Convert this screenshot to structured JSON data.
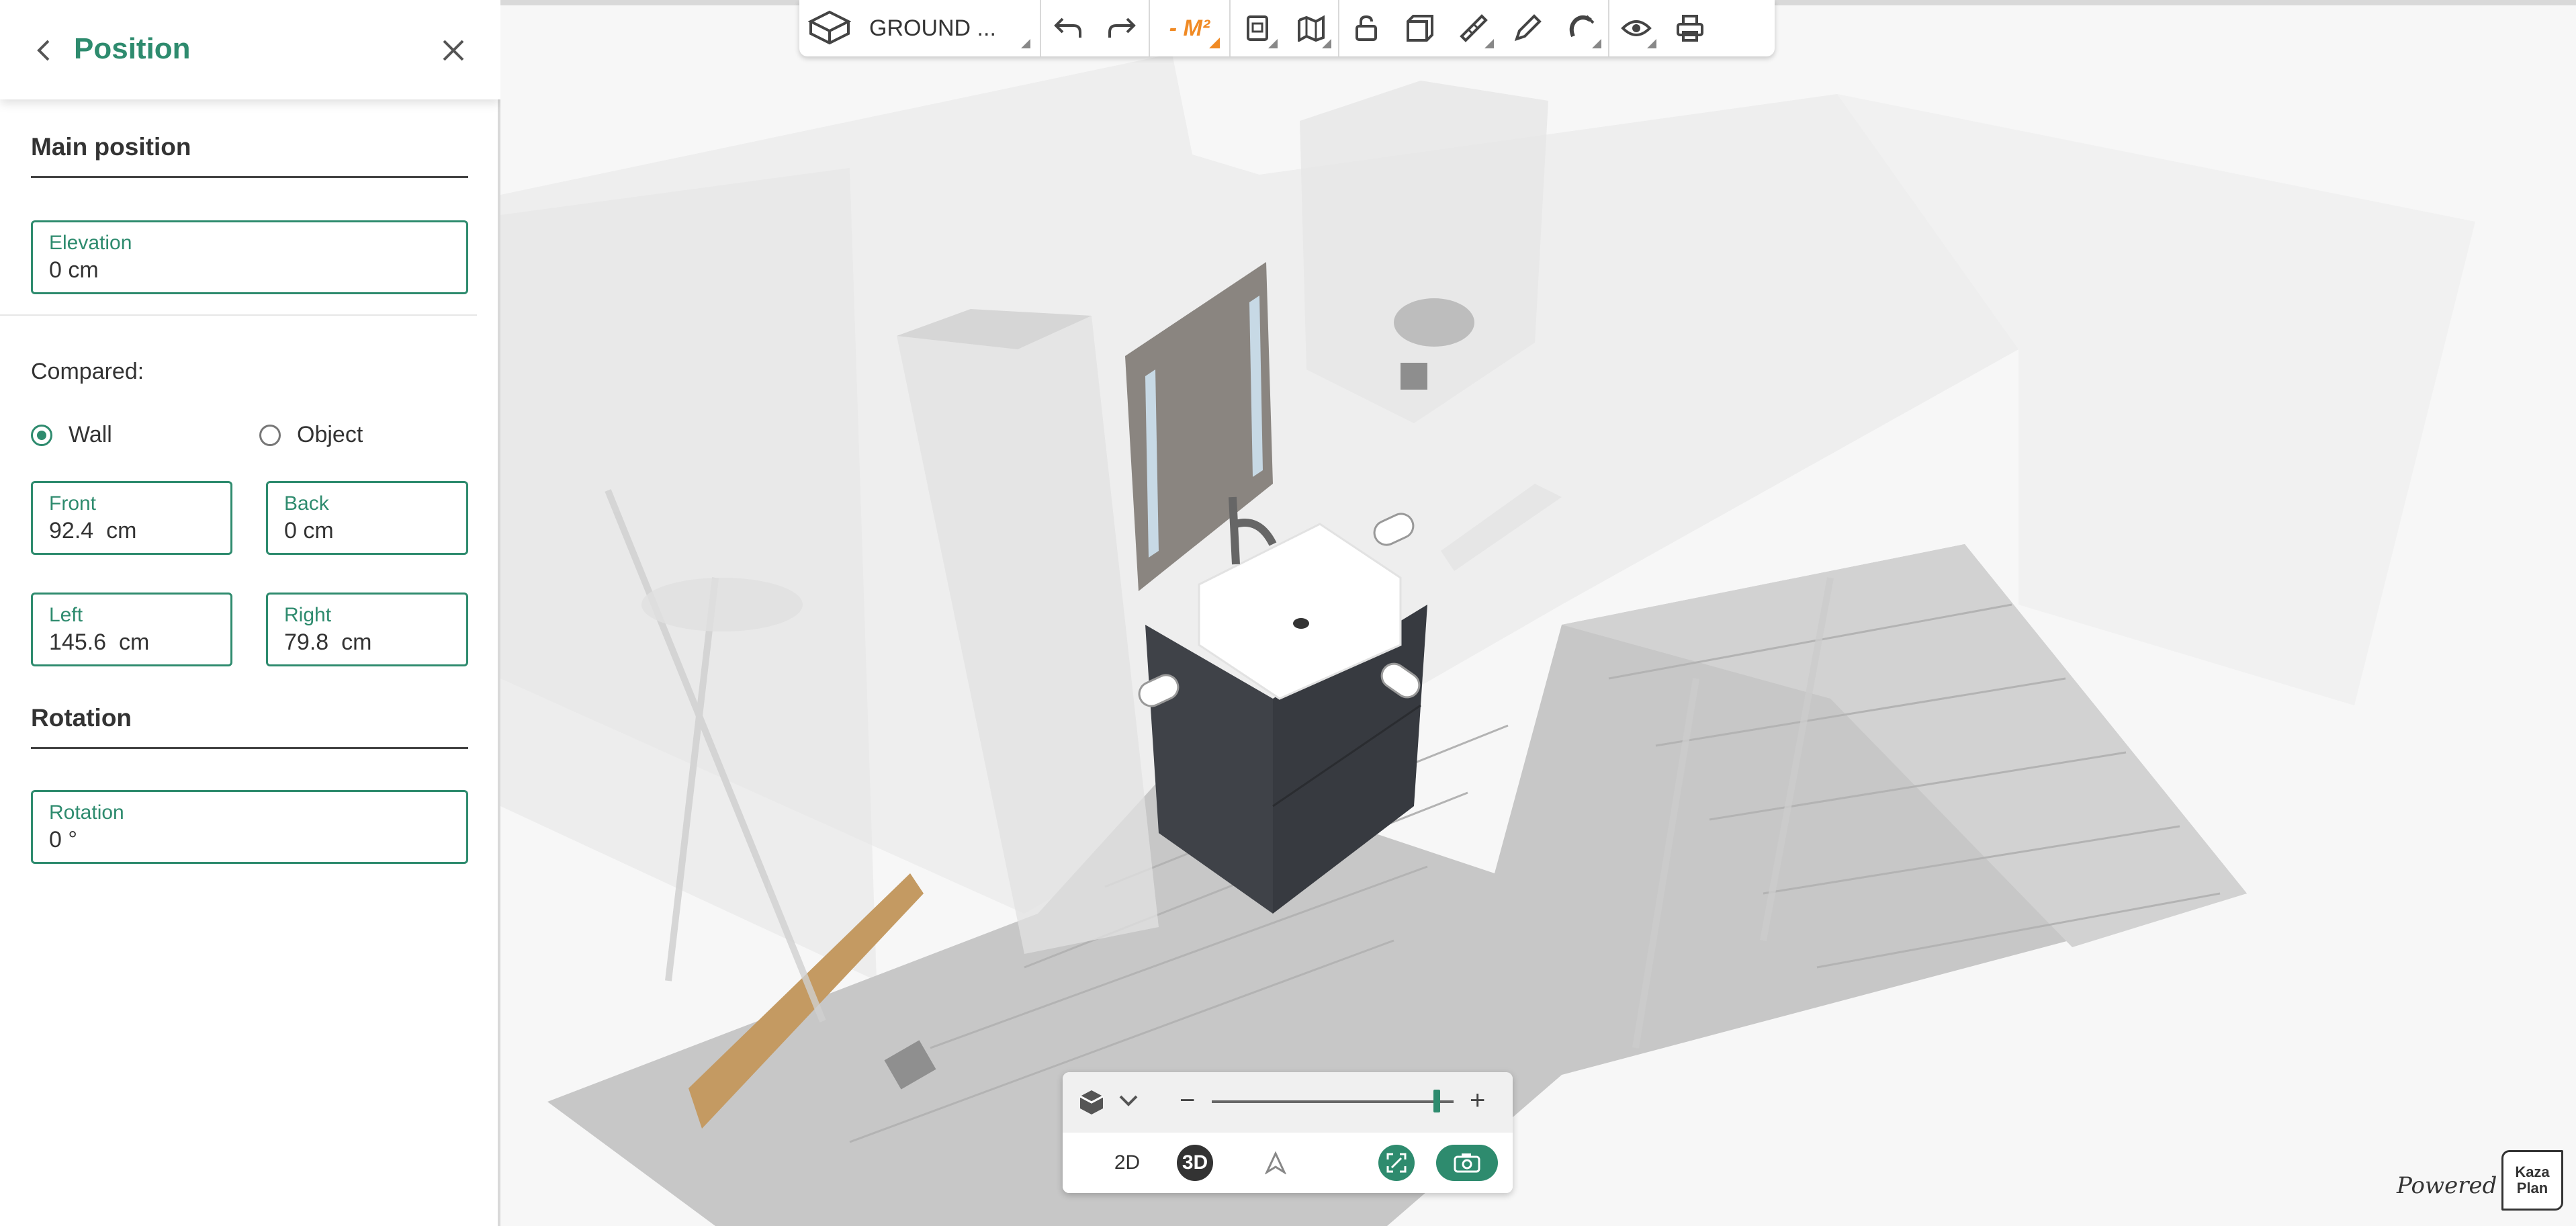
{
  "panel": {
    "title": "Position",
    "main_position_title": "Main position",
    "elevation": {
      "label": "Elevation",
      "value": "0 cm"
    },
    "compared_label": "Compared:",
    "radio_wall": "Wall",
    "radio_object": "Object",
    "radio_selected": "Wall",
    "front": {
      "label": "Front",
      "value": "92.4  cm"
    },
    "back": {
      "label": "Back",
      "value": "0 cm"
    },
    "left": {
      "label": "Left",
      "value": "145.6  cm"
    },
    "right": {
      "label": "Right",
      "value": "79.8  cm"
    },
    "rotation_title": "Rotation",
    "rotation": {
      "label": "Rotation",
      "value": "0 °"
    }
  },
  "toolbar": {
    "level_label": "GROUND ...",
    "m2_label": "- M²"
  },
  "view_controls": {
    "view_2d": "2D",
    "view_3d": "3D",
    "active_view": "3D",
    "zoom_minus": "−",
    "zoom_plus": "+",
    "zoom_level": 0.9
  },
  "branding": {
    "powered_by": "Powered by",
    "logo_line1": "Kaza",
    "logo_line2": "Plan"
  },
  "colors": {
    "accent": "#2e8b6e",
    "m2_orange": "#f08a24",
    "cabinet": "#3f4248"
  },
  "icons": [
    "back-arrow-icon",
    "close-icon",
    "floorplan-icon",
    "undo-icon",
    "redo-icon",
    "document-icon",
    "map-icon",
    "lock-icon",
    "cube-icon",
    "ruler-icon",
    "pencil-icon",
    "magnet-icon",
    "eye-icon",
    "printer-icon",
    "view-cube-icon",
    "chevron-down-icon",
    "compass-icon",
    "fit-screen-icon",
    "camera-icon"
  ]
}
